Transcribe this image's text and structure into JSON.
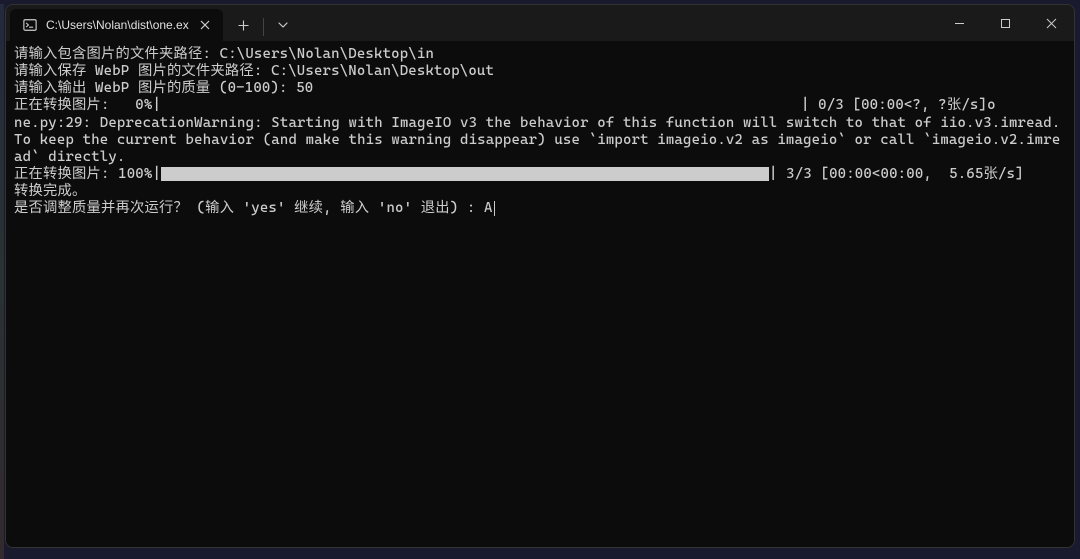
{
  "titlebar": {
    "tab_title": "C:\\Users\\Nolan\\dist\\one.ex",
    "tab_close_label": "✕",
    "new_tab_label": "+",
    "dropdown_label": "⌄"
  },
  "window_controls": {
    "minimize": "—",
    "maximize": "▢",
    "close": "✕"
  },
  "terminal": {
    "line1": "请输入包含图片的文件夹路径: C:\\Users\\Nolan\\Desktop\\in",
    "line2": "请输入保存 WebP 图片的文件夹路径: C:\\Users\\Nolan\\Desktop\\out",
    "line3": "请输入输出 WebP 图片的质量 (0-100): 50",
    "progress0_prefix": "正在转换图片:   0%|",
    "progress0_suffix": "| 0/3 [00:00<?, ?张/s]o",
    "warning": "ne.py:29: DeprecationWarning: Starting with ImageIO v3 the behavior of this function will switch to that of iio.v3.imread. To keep the current behavior (and make this warning disappear) use `import imageio.v2 as imageio` or call `imageio.v2.imread` directly.",
    "progress100_prefix": "正在转换图片: 100%|",
    "progress100_suffix": "| 3/3 [00:00<00:00,  5.65张/s]",
    "done": "转换完成。",
    "prompt": "是否调整质量并再次运行？ (输入 'yes' 继续, 输入 'no' 退出) : A"
  }
}
